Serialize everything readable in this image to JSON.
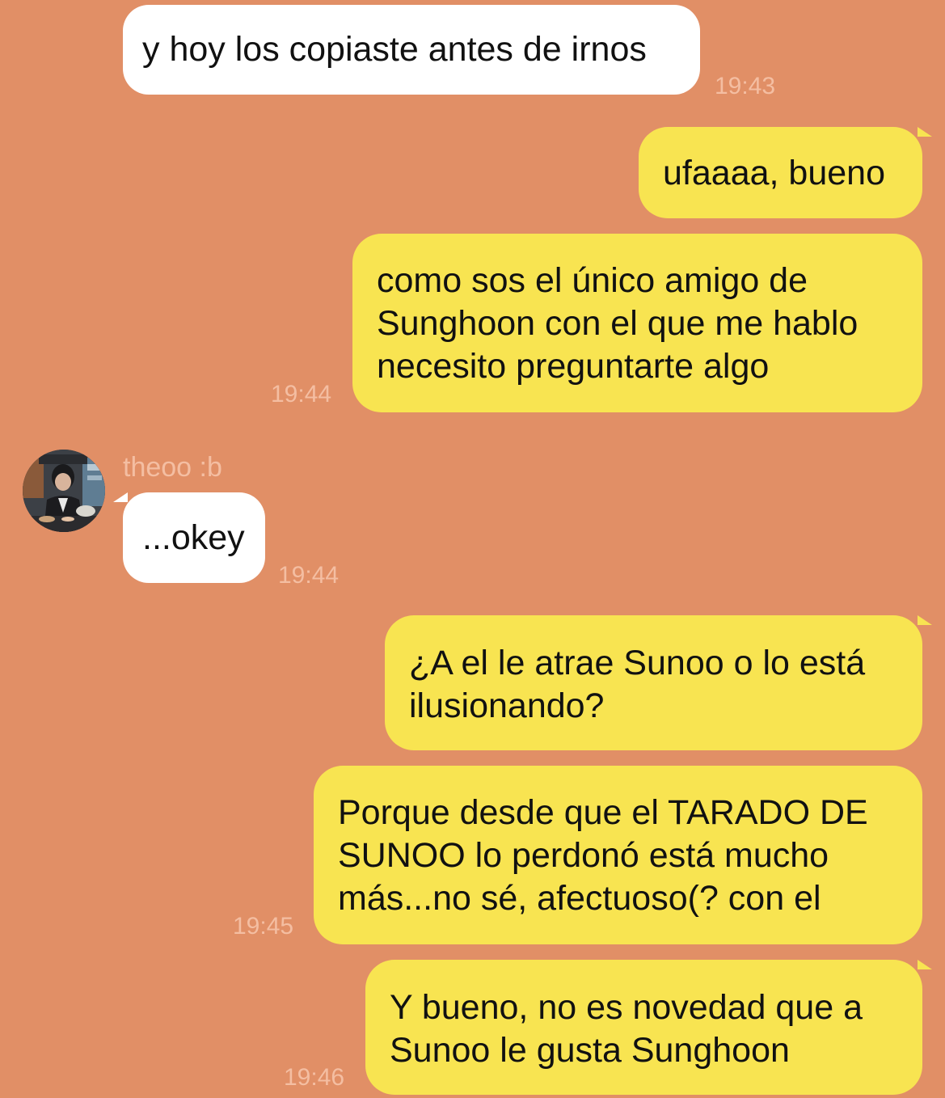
{
  "contact": {
    "name": "theoo :b"
  },
  "messages": [
    {
      "direction": "in",
      "lines": [
        "y hoy los copiaste antes de irnos"
      ],
      "time": "19:43"
    },
    {
      "direction": "out",
      "lines": [
        "ufaaaa, bueno"
      ],
      "time": ""
    },
    {
      "direction": "out",
      "lines": [
        "como sos el único amigo de",
        "Sunghoon con el que me hablo",
        "necesito preguntarte algo"
      ],
      "time": "19:44"
    },
    {
      "direction": "in",
      "lines": [
        "...okey"
      ],
      "time": "19:44"
    },
    {
      "direction": "out",
      "lines": [
        "¿A el le atrae Sunoo o lo está",
        "ilusionando?"
      ],
      "time": ""
    },
    {
      "direction": "out",
      "lines": [
        "Porque desde que el TARADO DE",
        "SUNOO lo perdonó está mucho",
        "más...no sé, afectuoso(? con el"
      ],
      "time": "19:45"
    },
    {
      "direction": "out",
      "lines": [
        "Y bueno, no es novedad que a",
        "Sunoo le gusta Sunghoon"
      ],
      "time": "19:46"
    }
  ],
  "colors": {
    "background": "#E18F66",
    "outgoing_bubble": "#F8E451",
    "incoming_bubble": "#FFFFFF",
    "meta_text": "#F4BEA2"
  }
}
